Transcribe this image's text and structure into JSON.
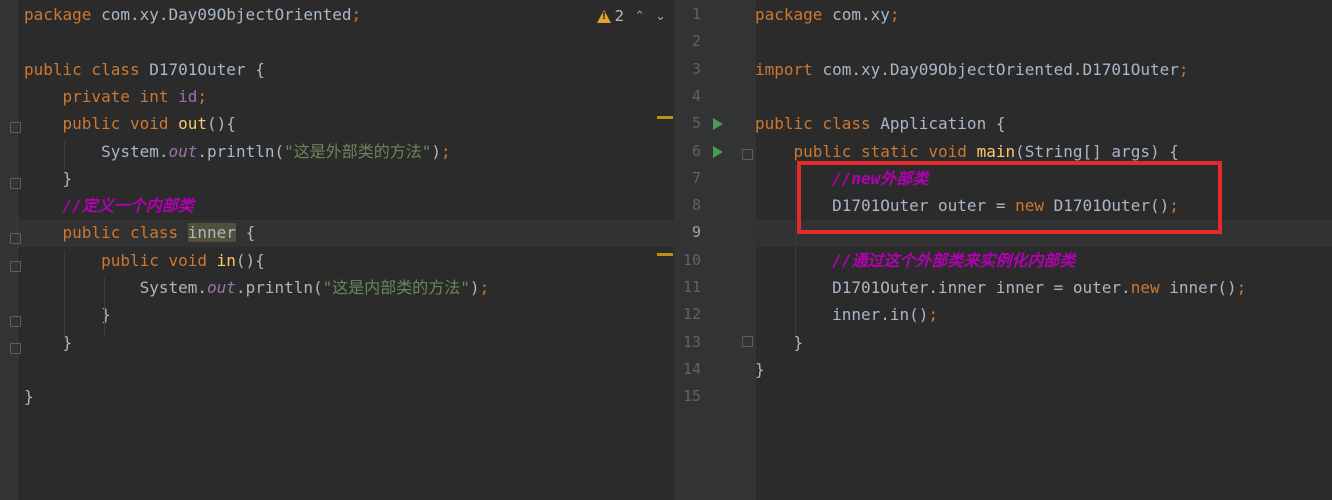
{
  "left_editor": {
    "warnings": {
      "count": "2"
    },
    "lines": [
      {
        "tokens": [
          {
            "t": "package ",
            "c": "kw"
          },
          {
            "t": "com.xy.Day09ObjectOriented",
            "c": ""
          },
          {
            "t": ";",
            "c": "kw"
          }
        ]
      },
      {
        "tokens": []
      },
      {
        "tokens": [
          {
            "t": "public class ",
            "c": "kw"
          },
          {
            "t": "D1701Outer {",
            "c": ""
          }
        ]
      },
      {
        "tokens": [
          {
            "t": "    private int ",
            "c": "kw"
          },
          {
            "t": "id",
            "c": "fld"
          },
          {
            "t": ";",
            "c": "kw"
          }
        ]
      },
      {
        "tokens": [
          {
            "t": "    public void ",
            "c": "kw"
          },
          {
            "t": "out",
            "c": "fn"
          },
          {
            "t": "(){",
            "c": ""
          }
        ]
      },
      {
        "tokens": [
          {
            "t": "        System.",
            "c": ""
          },
          {
            "t": "out",
            "c": "fld-i"
          },
          {
            "t": ".println(",
            "c": ""
          },
          {
            "t": "\"这是外部类的方法\"",
            "c": "str"
          },
          {
            "t": ")",
            "c": ""
          },
          {
            "t": ";",
            "c": "kw"
          }
        ]
      },
      {
        "tokens": [
          {
            "t": "    }",
            "c": ""
          }
        ]
      },
      {
        "tokens": [
          {
            "t": "    ",
            "c": ""
          },
          {
            "t": "//定义一个内部类",
            "c": "cmt"
          }
        ]
      },
      {
        "tokens": [
          {
            "t": "    public class ",
            "c": "kw"
          },
          {
            "t": "inner",
            "c": "hl"
          },
          {
            "t": " {",
            "c": ""
          }
        ]
      },
      {
        "tokens": [
          {
            "t": "        public void ",
            "c": "kw"
          },
          {
            "t": "in",
            "c": "fn"
          },
          {
            "t": "(){",
            "c": ""
          }
        ]
      },
      {
        "tokens": [
          {
            "t": "            System.",
            "c": ""
          },
          {
            "t": "out",
            "c": "fld-i"
          },
          {
            "t": ".println(",
            "c": ""
          },
          {
            "t": "\"这是内部类的方法\"",
            "c": "str"
          },
          {
            "t": ")",
            "c": ""
          },
          {
            "t": ";",
            "c": "kw"
          }
        ]
      },
      {
        "tokens": [
          {
            "t": "        }",
            "c": ""
          }
        ]
      },
      {
        "tokens": [
          {
            "t": "    }",
            "c": ""
          }
        ]
      },
      {
        "tokens": []
      },
      {
        "tokens": [
          {
            "t": "}",
            "c": ""
          }
        ]
      }
    ]
  },
  "right_editor": {
    "line_numbers": [
      "1",
      "2",
      "3",
      "4",
      "5",
      "6",
      "7",
      "8",
      "9",
      "10",
      "11",
      "12",
      "13",
      "14",
      "15"
    ],
    "lines": [
      {
        "tokens": [
          {
            "t": "package ",
            "c": "kw"
          },
          {
            "t": "com.xy",
            "c": ""
          },
          {
            "t": ";",
            "c": "kw"
          }
        ]
      },
      {
        "tokens": []
      },
      {
        "tokens": [
          {
            "t": "import ",
            "c": "kw"
          },
          {
            "t": "com.xy.Day09ObjectOriented.D1701Outer",
            "c": ""
          },
          {
            "t": ";",
            "c": "kw"
          }
        ]
      },
      {
        "tokens": []
      },
      {
        "tokens": [
          {
            "t": "public class ",
            "c": "kw"
          },
          {
            "t": "Application {",
            "c": ""
          }
        ]
      },
      {
        "tokens": [
          {
            "t": "    public static void ",
            "c": "kw"
          },
          {
            "t": "main",
            "c": "fn"
          },
          {
            "t": "(String[] args) {",
            "c": ""
          }
        ]
      },
      {
        "tokens": [
          {
            "t": "        ",
            "c": ""
          },
          {
            "t": "//new外部类",
            "c": "cmt"
          }
        ]
      },
      {
        "tokens": [
          {
            "t": "        D1701Outer outer = ",
            "c": ""
          },
          {
            "t": "new ",
            "c": "kw"
          },
          {
            "t": "D1701Outer()",
            "c": ""
          },
          {
            "t": ";",
            "c": "kw"
          }
        ]
      },
      {
        "tokens": []
      },
      {
        "tokens": [
          {
            "t": "        ",
            "c": ""
          },
          {
            "t": "//通过这个外部类来实例化内部类",
            "c": "cmt"
          }
        ]
      },
      {
        "tokens": [
          {
            "t": "        D1701Outer.inner inner = outer.",
            "c": ""
          },
          {
            "t": "new ",
            "c": "kw"
          },
          {
            "t": "inner()",
            "c": ""
          },
          {
            "t": ";",
            "c": "kw"
          }
        ]
      },
      {
        "tokens": [
          {
            "t": "        inner.in()",
            "c": ""
          },
          {
            "t": ";",
            "c": "kw"
          }
        ]
      },
      {
        "tokens": [
          {
            "t": "    }",
            "c": ""
          }
        ]
      },
      {
        "tokens": [
          {
            "t": "}",
            "c": ""
          }
        ]
      },
      {
        "tokens": []
      }
    ]
  },
  "colors": {
    "background": "#2b2b2b",
    "keyword": "#cc7832",
    "string": "#6a8759",
    "comment": "#b200b2",
    "method": "#ffc66d",
    "field": "#9876aa",
    "annotation_box": "#e32b2b"
  },
  "icons": [
    "warning-icon",
    "chevron-up-icon",
    "chevron-down-icon",
    "run-gutter-icon",
    "fold-icon"
  ]
}
